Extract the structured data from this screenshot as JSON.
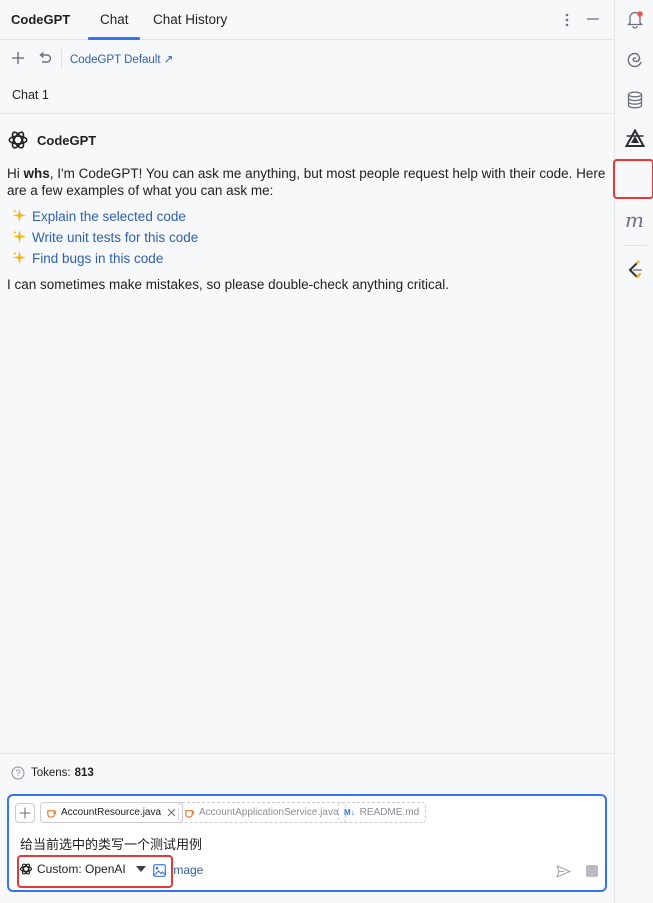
{
  "header": {
    "app_title": "CodeGPT",
    "tabs": [
      {
        "label": "Chat",
        "active": true
      },
      {
        "label": "Chat History",
        "active": false
      }
    ]
  },
  "toolbar": {
    "persona_label": "CodeGPT Default ↗"
  },
  "subtabs": {
    "items": [
      {
        "label": "Chat 1"
      }
    ]
  },
  "message": {
    "sender": "CodeGPT",
    "greeting_prefix": "Hi ",
    "greeting_user": "whs",
    "greeting_suffix": ", I'm CodeGPT! You can ask me anything, but most people request help with their code. Here are a few examples of what you can ask me:",
    "suggestions": [
      {
        "label": "Explain the selected code"
      },
      {
        "label": "Write unit tests for this code"
      },
      {
        "label": "Find bugs in this code"
      }
    ],
    "disclaimer": "I can sometimes make mistakes, so please double-check anything critical."
  },
  "footer": {
    "tokens_label": "Tokens:",
    "tokens_count": "813",
    "attachments": [
      {
        "label": "AccountResource.java",
        "state": "selected",
        "icon": "java-file-icon"
      },
      {
        "label": "AccountApplicationService.java",
        "state": "suggested",
        "icon": "java-file-icon"
      },
      {
        "label": "README.md",
        "state": "suggested",
        "icon": "markdown-file-icon",
        "badge": "M↓"
      }
    ],
    "prompt_value": "给当前选中的类写一个测试用例",
    "model_label": "Custom: OpenAI",
    "image_label": "Image"
  },
  "colors": {
    "accent": "#3574f0",
    "link": "#2f5fb3",
    "highlight": "#e53935",
    "background": "#f7f8fa"
  },
  "right_bar": {
    "icons": [
      "notifications-bell-icon",
      "swirl-plugin-icon",
      "database-icon",
      "triangle-plugin-icon",
      "codegpt-icon",
      "m-plugin-icon",
      "leetcode-icon"
    ],
    "m_glyph": "m"
  }
}
